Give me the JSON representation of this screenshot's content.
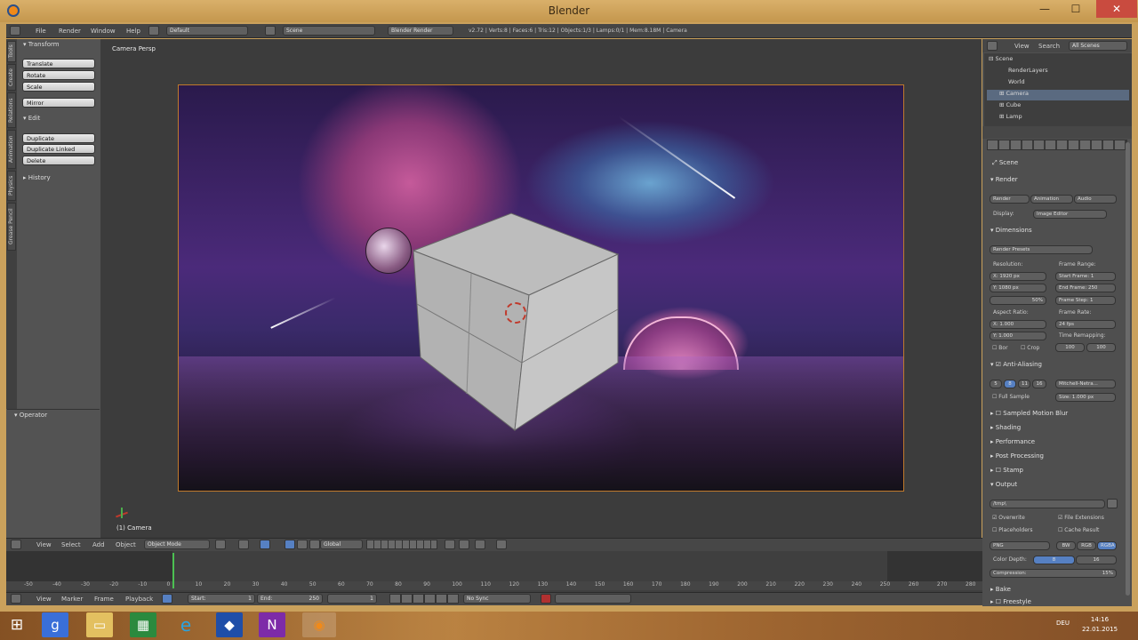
{
  "window": {
    "title": "Blender",
    "minimize": "—",
    "maximize": "☐",
    "close": "✕"
  },
  "info_bar": {
    "menus": [
      "File",
      "Render",
      "Window",
      "Help"
    ],
    "layout": "Default",
    "scene": "Scene",
    "engine": "Blender Render",
    "stats": "v2.72 | Verts:8 | Faces:6 | Tris:12 | Objects:1/3 | Lamps:0/1 | Mem:8.18M | Camera"
  },
  "tool_tabs": [
    "Tools",
    "Create",
    "Relations",
    "Animation",
    "Physics",
    "Grease Pencil"
  ],
  "tool_shelf": {
    "transform_header": "Transform",
    "transform_buttons": [
      "Translate",
      "Rotate",
      "Scale"
    ],
    "mirror": "Mirror",
    "edit_header": "Edit",
    "edit_buttons": [
      "Duplicate",
      "Duplicate Linked",
      "Delete"
    ],
    "history_header": "History",
    "operator_header": "Operator"
  },
  "viewport": {
    "view_label": "Camera Persp",
    "object_label": "(1) Camera"
  },
  "header_3d": {
    "menus": [
      "View",
      "Select",
      "Add",
      "Object"
    ],
    "mode": "Object Mode",
    "orientation": "Global"
  },
  "timeline": {
    "ruler": [
      "-50",
      "-40",
      "-30",
      "-20",
      "-10",
      "0",
      "10",
      "20",
      "30",
      "40",
      "50",
      "60",
      "70",
      "80",
      "90",
      "100",
      "110",
      "120",
      "130",
      "140",
      "150",
      "160",
      "170",
      "180",
      "190",
      "200",
      "210",
      "220",
      "230",
      "240",
      "250",
      "260",
      "270",
      "280"
    ],
    "menus": [
      "View",
      "Marker",
      "Frame",
      "Playback"
    ],
    "start": "Start:",
    "start_val": "1",
    "end": "End:",
    "end_val": "250",
    "current": "1",
    "sync": "No Sync"
  },
  "outliner": {
    "tabs": [
      "View",
      "Search",
      "All Scenes"
    ],
    "rows": [
      "Scene",
      "RenderLayers",
      "World",
      "Camera",
      "Cube",
      "Lamp"
    ]
  },
  "properties": {
    "context": "Scene",
    "render_header": "Render",
    "render_buttons": [
      "Render",
      "Animation",
      "Audio"
    ],
    "display_label": "Display:",
    "display_value": "Image Editor",
    "dimensions_header": "Dimensions",
    "render_presets": "Render Presets",
    "resolution_label": "Resolution:",
    "res_x": "X:     1920 px",
    "res_y": "Y:     1080 px",
    "res_pct": "50%",
    "frame_range_label": "Frame Range:",
    "start_frame": "Start Frame:   1",
    "end_frame": "End Frame:  250",
    "frame_step": "Frame Step:    1",
    "aspect_label": "Aspect Ratio:",
    "aspect_x": "X:     1.000",
    "aspect_y": "Y:     1.000",
    "frame_rate_label": "Frame Rate:",
    "frame_rate": "24 fps",
    "time_remap_label": "Time Remapping:",
    "remap_old": "100",
    "remap_new": "100",
    "border": "Bor",
    "crop": "Crop",
    "aa_header": "Anti-Aliasing",
    "aa_samples": [
      "5",
      "8",
      "11",
      "16"
    ],
    "aa_filter": "Mitchell-Netra...",
    "full_sample": "Full Sample",
    "filter_size": "Size: 1.000 px",
    "sections": [
      "Sampled Motion Blur",
      "Shading",
      "Performance",
      "Post Processing",
      "Stamp"
    ],
    "output_header": "Output",
    "output_path": "/tmp\\",
    "overwrite": "Overwrite",
    "file_ext": "File Extensions",
    "placeholders": "Placeholders",
    "cache_result": "Cache Result",
    "format": "PNG",
    "color_modes": [
      "BW",
      "RGB",
      "RGBA"
    ],
    "color_depth_label": "Color Depth:",
    "depth_8": "8",
    "depth_16": "16",
    "compression": "Compression:",
    "compression_val": "15%",
    "bake_header": "Bake",
    "freestyle_header": "Freestyle"
  },
  "taskbar": {
    "icons": [
      "windows-icon",
      "chrome-icon",
      "explorer-icon",
      "store-icon",
      "ie-icon",
      "app-icon",
      "onenote-icon",
      "blender-icon"
    ],
    "lang": "DEU",
    "time": "14:16",
    "date": "22.01.2015"
  }
}
